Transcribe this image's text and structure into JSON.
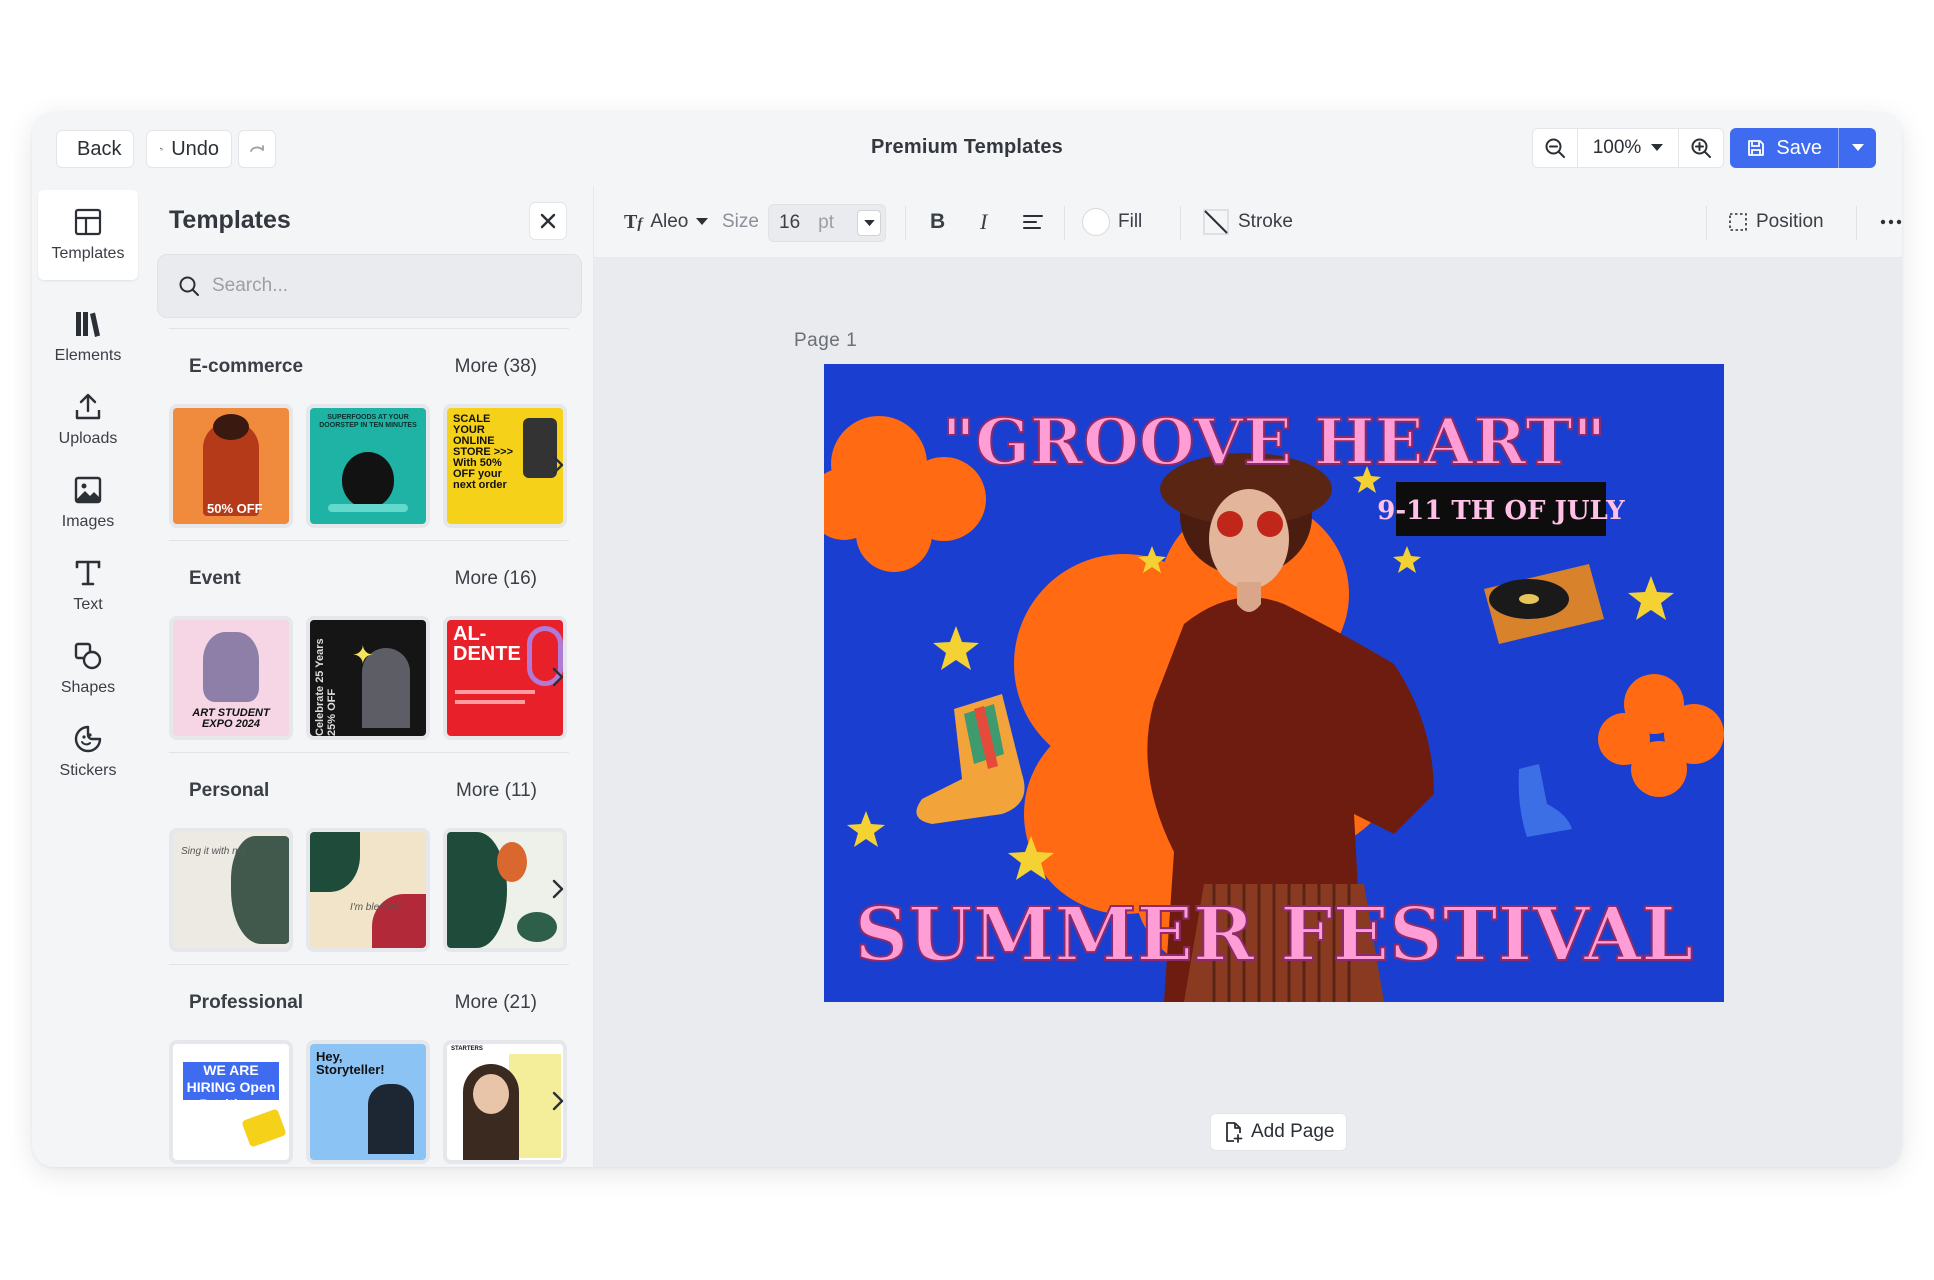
{
  "topbar": {
    "back_label": "Back",
    "undo_label": "Undo",
    "title": "Premium Templates",
    "zoom_value": "100%",
    "save_label": "Save"
  },
  "rail": {
    "items": [
      {
        "label": "Templates",
        "icon": "layout-icon"
      },
      {
        "label": "Elements",
        "icon": "books-icon"
      },
      {
        "label": "Uploads",
        "icon": "upload-icon"
      },
      {
        "label": "Images",
        "icon": "image-icon"
      },
      {
        "label": "Text",
        "icon": "text-icon"
      },
      {
        "label": "Shapes",
        "icon": "shapes-icon"
      },
      {
        "label": "Stickers",
        "icon": "sticker-icon"
      }
    ]
  },
  "panel": {
    "title": "Templates",
    "search_placeholder": "Search...",
    "categories": [
      {
        "name": "E-commerce",
        "more": "More (38)",
        "thumbs": [
          {
            "bg": "#f08a3c",
            "text": "50% OFF"
          },
          {
            "bg": "#1fb3a6",
            "text": "SUPERFOODS AT YOUR DOORSTEP IN TEN MINUTES"
          },
          {
            "bg": "#f5d11a",
            "text": "SCALE YOUR ONLINE STORE >>> With 50% OFF your next order"
          }
        ]
      },
      {
        "name": "Event",
        "more": "More (16)",
        "thumbs": [
          {
            "bg": "#f6d6e4",
            "text": "ART STUDENT EXPO 2024"
          },
          {
            "bg": "#151515",
            "text": "Celebrate 25 Years 25% OFF"
          },
          {
            "bg": "#e8202a",
            "text": "AL-DENTE"
          }
        ]
      },
      {
        "name": "Personal",
        "more": "More (11)",
        "thumbs": [
          {
            "bg": "#eceae3",
            "text": "Sing it with me"
          },
          {
            "bg": "#f2e4c9",
            "text": "I'm blessed"
          },
          {
            "bg": "#eef0ea",
            "text": ""
          }
        ]
      },
      {
        "name": "Professional",
        "more": "More (21)",
        "thumbs": [
          {
            "bg": "#ffffff",
            "text": "WE ARE HIRING Open Positions"
          },
          {
            "bg": "#8cc3f5",
            "text": "Hey, Storyteller!"
          },
          {
            "bg": "#f4ee9b",
            "text": "STARTERS"
          }
        ]
      }
    ]
  },
  "context_toolbar": {
    "font_name": "Aleo",
    "size_label": "Size",
    "size_value": "16",
    "size_unit": "pt",
    "fill_label": "Fill",
    "stroke_label": "Stroke",
    "position_label": "Position"
  },
  "canvas": {
    "page_label": "Page 1",
    "add_page_label": "Add Page",
    "design": {
      "headline": "\"GROOVE HEART\"",
      "date_banner": "9-11 TH OF JULY",
      "footer": "SUMMER FESTIVAL",
      "bg_color": "#1a3fd0",
      "accent_color": "#ff6a13",
      "text_color": "#ff9ed6"
    }
  },
  "colors": {
    "brand": "#3e6bf0",
    "panel_bg": "#f4f5f7",
    "canvas_bg": "#e9ebee"
  }
}
